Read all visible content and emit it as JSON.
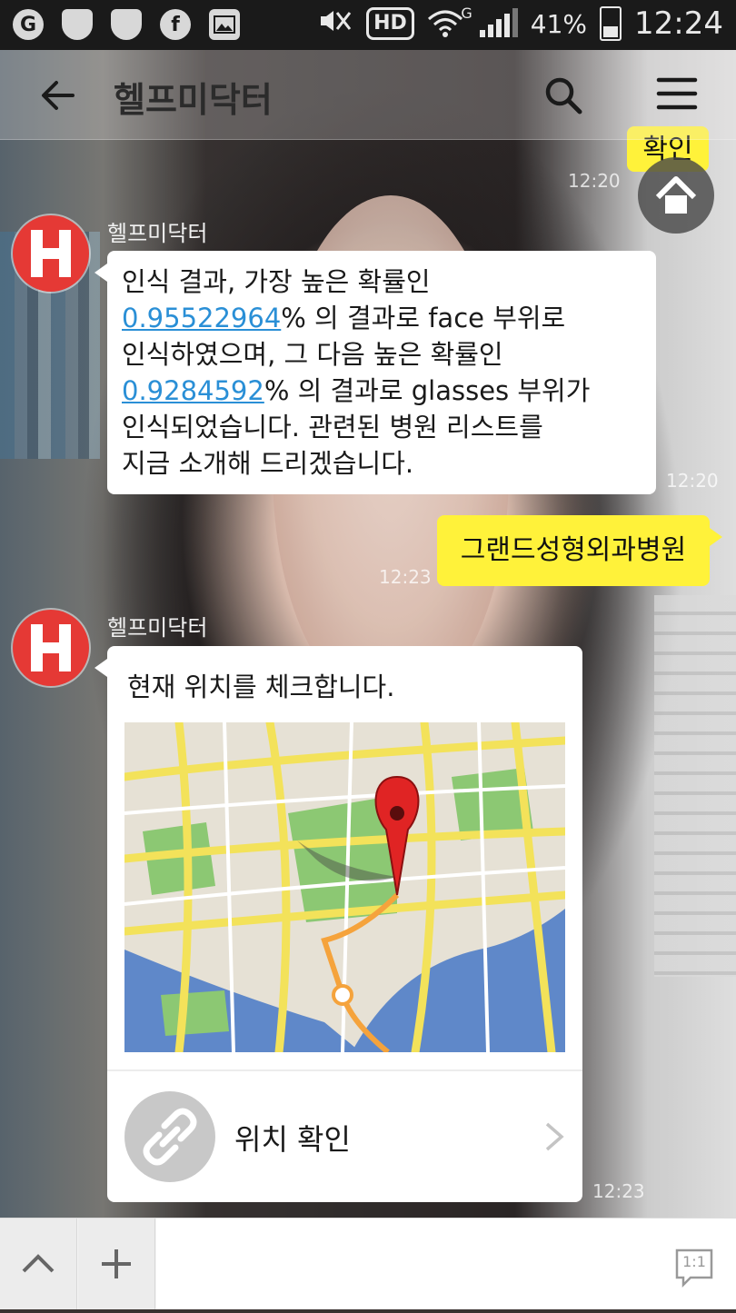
{
  "status_bar": {
    "hd_label": "HD",
    "network_label": "G",
    "battery": "41%",
    "time": "12:24"
  },
  "header": {
    "title": "헬프미닥터"
  },
  "messages": {
    "confirm_sent": {
      "text": "확인",
      "time": "12:20"
    },
    "bot_result": {
      "sender": "헬프미닥터",
      "line1": "인식 결과, 가장 높은 확률인",
      "prob1": "0.95522964",
      "line2_rest": "% 의 결과로 face 부위로",
      "line3": "인식하였으며, 그 다음 높은 확률인",
      "prob2": "0.9284592",
      "line4_rest": "% 의 결과로 glasses 부위가",
      "line5": "인식되었습니다. 관련된 병원 리스트를",
      "line6": "지금 소개해 드리겠습니다.",
      "time": "12:20"
    },
    "hospital_sent": {
      "text": "그랜드성형외과병원",
      "time": "12:23"
    },
    "bot_location": {
      "sender": "헬프미닥터",
      "text": "현재 위치를 체크합니다.",
      "link_label": "위치 확인",
      "time": "12:23"
    }
  },
  "bottom_bar": {
    "mode_label": "1:1"
  },
  "colors": {
    "bubble_yellow": "#fff23a",
    "avatar_red": "#e53935",
    "link_blue": "#2a8fd6",
    "map_pin": "#e02424"
  }
}
